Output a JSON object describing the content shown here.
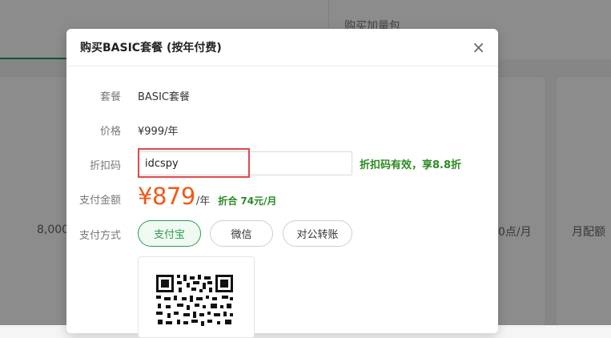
{
  "background": {
    "right_tab_label": "购买加量包",
    "left_card_value": "8,000",
    "right_card_value": "0点/月",
    "far_right_value": "月配额"
  },
  "modal": {
    "title": "购买BASIC套餐 (按年付费)",
    "close_symbol": "×",
    "rows": {
      "plan_label": "套餐",
      "plan_value": "BASIC套餐",
      "price_label": "价格",
      "price_value": "¥999/年",
      "discount_label": "折扣码",
      "discount_value": "idcspy",
      "discount_status": "折扣码有效，享8.8折",
      "pay_amount_label": "支付金额",
      "pay_amount_value": "¥879",
      "pay_amount_unit": "/年",
      "pay_amount_monthly": "折合 74元/月",
      "pay_method_label": "支付方式"
    },
    "payment_methods": [
      {
        "label": "支付宝",
        "selected": true
      },
      {
        "label": "微信",
        "selected": false
      },
      {
        "label": "对公转账",
        "selected": false
      }
    ]
  },
  "colors": {
    "accent_green": "#2a9c4e",
    "price_orange": "#ef5a1a",
    "highlight_red": "#e0484d"
  }
}
